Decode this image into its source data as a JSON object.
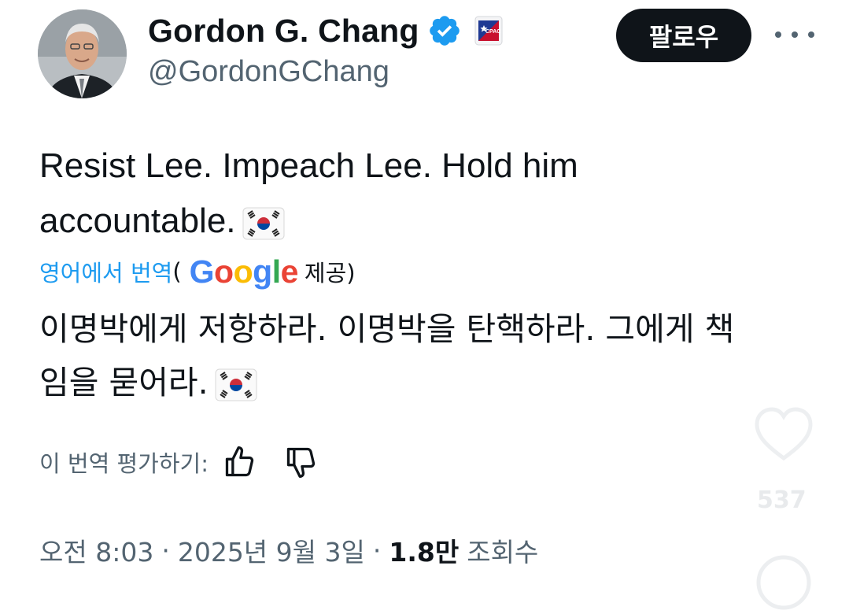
{
  "author": {
    "display_name": "Gordon G. Chang",
    "handle": "@GordonGChang",
    "verified_icon": "verified-badge-icon",
    "affiliation_icon": "cpac-badge-icon",
    "affiliation_text": "CPAC"
  },
  "actions": {
    "follow_label": "팔로우",
    "more_icon": "more-options-icon"
  },
  "tweet": {
    "text_line1": "Resist Lee. Impeach Lee. Hold him",
    "text_line2": "accountable.",
    "flag_icon": "south-korea-flag-icon"
  },
  "translation": {
    "link_label": "영어에서 번역",
    "open_paren": "(",
    "provider": "Google",
    "provider_letters": [
      "G",
      "o",
      "o",
      "g",
      "l",
      "e"
    ],
    "provided_label": "제공)",
    "text_line1": "이명박에게 저항하라. 이명박을 탄핵하라. 그에게 책",
    "text_line2": "임을 묻어라.",
    "rate_label": "이 번역 평가하기:",
    "thumbs_up_icon": "thumbs-up-icon",
    "thumbs_down_icon": "thumbs-down-icon"
  },
  "meta": {
    "time": "오전 8:03",
    "separator": "·",
    "date": "2025년 9월 3일",
    "views_count": "1.8만",
    "views_label": "조회수"
  },
  "overlay": {
    "like_icon": "heart-icon",
    "like_count": "537"
  },
  "colors": {
    "link_blue": "#1d9bf0",
    "secondary_text": "#536471",
    "follow_bg": "#0f1419",
    "verified_blue": "#1d9bf0"
  }
}
